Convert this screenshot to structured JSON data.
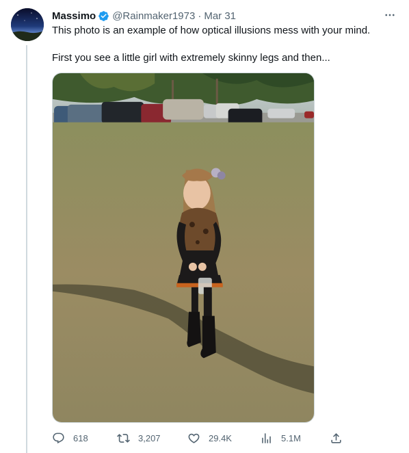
{
  "tweet": {
    "author": {
      "name": "Massimo",
      "handle": "@Rainmaker1973",
      "verified": true,
      "avatar_icon": "night-sky-avatar"
    },
    "separator": "·",
    "date": "Mar 31",
    "text_line1": "This photo is an example of how optical illusions mess with your mind.",
    "text_line2": "First you see a little girl with extremely skinny legs and then...",
    "media_description_icon": "photo-girl-standing-on-grass",
    "metrics": {
      "replies": "618",
      "retweets": "3,207",
      "likes": "29.4K",
      "views": "5.1M"
    },
    "colors": {
      "text": "#0f1419",
      "secondary": "#536471",
      "verified": "#1d9bf0",
      "thread_line": "#cfd9de"
    }
  }
}
